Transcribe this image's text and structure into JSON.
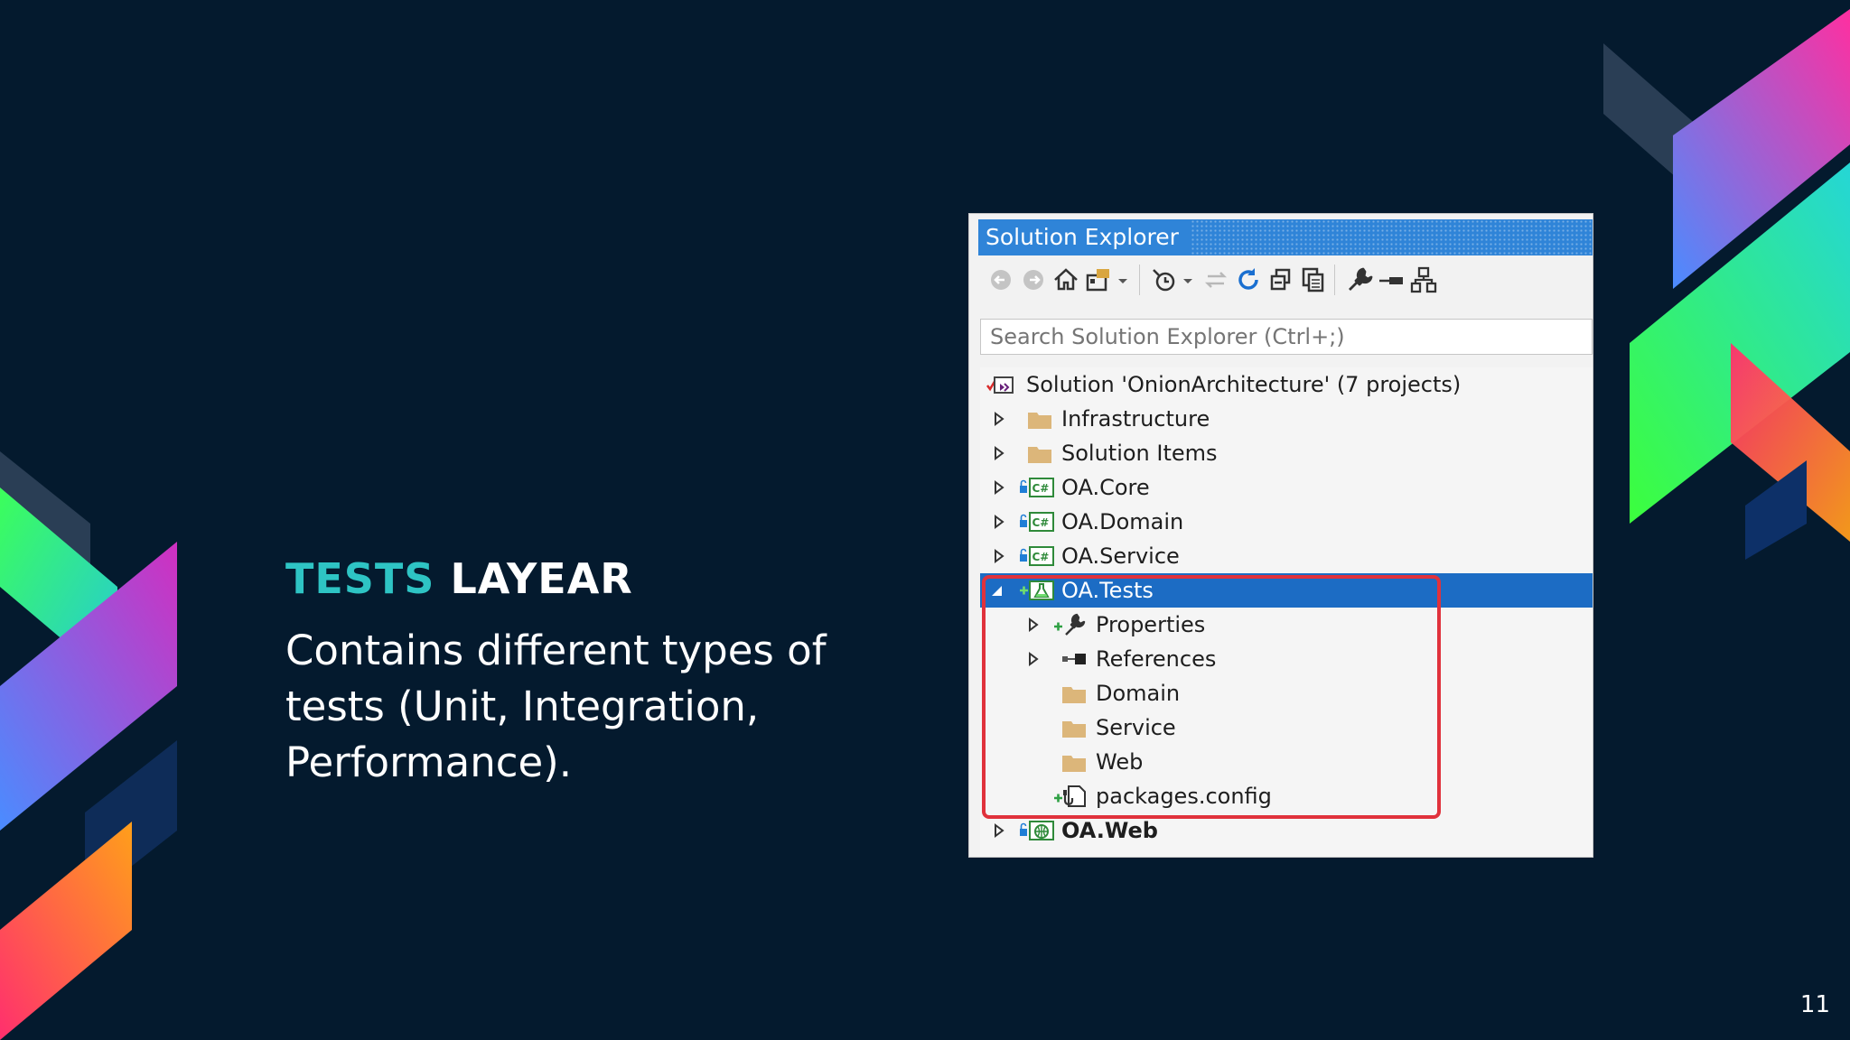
{
  "slide": {
    "title_accent": "TESTS",
    "title_rest": "LAYEAR",
    "body": "Contains different types of tests (Unit, Integration, Performance).",
    "page_number": "11"
  },
  "solution_explorer": {
    "title": "Solution Explorer",
    "search_placeholder": "Search Solution Explorer (Ctrl+;)",
    "toolbar_icons": [
      "back-icon",
      "forward-icon",
      "home-icon",
      "switch-views-icon",
      "dropdown-icon",
      "pending-changes-icon",
      "dropdown-icon",
      "sync-icon",
      "refresh-icon",
      "collapse-all-icon",
      "show-all-files-icon",
      "properties-wrench-icon",
      "preview-icon",
      "class-view-icon"
    ],
    "tree": [
      {
        "label": "Solution 'OnionArchitecture' (7 projects)",
        "icon": "solution-icon",
        "level": 0,
        "expander": "none"
      },
      {
        "label": "Infrastructure",
        "icon": "folder-icon",
        "level": 1,
        "expander": "collapsed"
      },
      {
        "label": "Solution Items",
        "icon": "folder-icon",
        "level": 1,
        "expander": "collapsed"
      },
      {
        "label": "OA.Core",
        "icon": "csharp-project-icon",
        "level": 1,
        "expander": "collapsed"
      },
      {
        "label": "OA.Domain",
        "icon": "csharp-project-icon",
        "level": 1,
        "expander": "collapsed"
      },
      {
        "label": "OA.Service",
        "icon": "csharp-project-icon",
        "level": 1,
        "expander": "collapsed"
      },
      {
        "label": "OA.Tests",
        "icon": "test-project-icon",
        "level": 1,
        "expander": "expanded",
        "selected": true
      },
      {
        "label": "Properties",
        "icon": "wrench-icon",
        "level": 2,
        "expander": "collapsed"
      },
      {
        "label": "References",
        "icon": "references-icon",
        "level": 2,
        "expander": "collapsed"
      },
      {
        "label": "Domain",
        "icon": "folder-icon",
        "level": 2,
        "expander": "none"
      },
      {
        "label": "Service",
        "icon": "folder-icon",
        "level": 2,
        "expander": "none"
      },
      {
        "label": "Web",
        "icon": "folder-icon",
        "level": 2,
        "expander": "none"
      },
      {
        "label": "packages.config",
        "icon": "config-file-icon",
        "level": 2,
        "expander": "none"
      },
      {
        "label": "OA.Web",
        "icon": "web-project-icon",
        "level": 1,
        "expander": "collapsed",
        "bold": true
      }
    ]
  },
  "colors": {
    "background": "#041a2e",
    "accent": "#2ec4c4",
    "selection": "#1c6cc4",
    "highlight_box": "#e0323c"
  }
}
